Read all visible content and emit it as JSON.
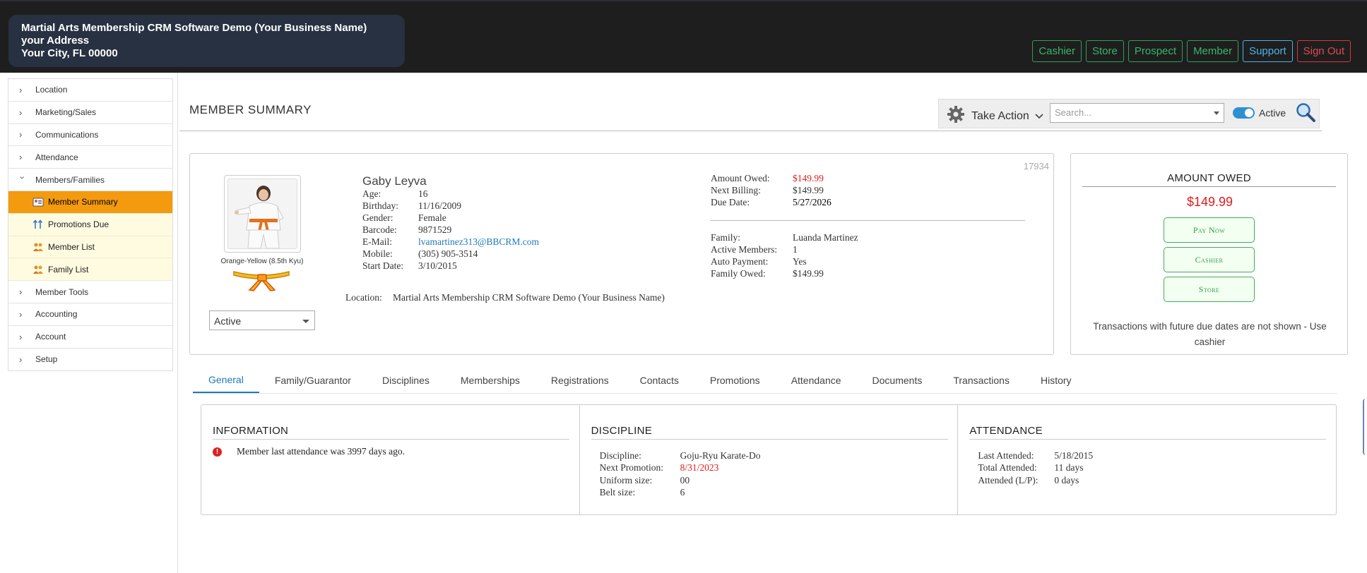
{
  "header": {
    "business_line1": "Martial Arts Membership CRM Software Demo (Your Business Name)",
    "business_line2": "your Address",
    "business_line3": "Your City, FL 00000",
    "nav": [
      "Cashier",
      "Store",
      "Prospect",
      "Member",
      "Support",
      "Sign Out"
    ]
  },
  "sidebar": {
    "items_top": [
      "Location",
      "Marketing/Sales",
      "Communications",
      "Attendance",
      "Members/Families"
    ],
    "sub_items": [
      "Member Summary",
      "Promotions Due",
      "Member List",
      "Family List"
    ],
    "items_bottom": [
      "Member Tools",
      "Accounting",
      "Account",
      "Setup"
    ]
  },
  "page": {
    "title": "MEMBER SUMMARY",
    "take_action": "Take Action",
    "search_placeholder": "Search...",
    "active_label": "Active"
  },
  "member": {
    "id": "17934",
    "name": "Gaby Leyva",
    "rank": "Orange-Yellow (8.5th Kyu)",
    "status": "Active",
    "details": [
      {
        "label": "Age:",
        "value": "16"
      },
      {
        "label": "Birthday:",
        "value": "11/16/2009"
      },
      {
        "label": "Gender:",
        "value": "Female"
      },
      {
        "label": "Barcode:",
        "value": "9871529"
      },
      {
        "label": "E-Mail:",
        "value": "lvamartinez313@BBCRM.com"
      },
      {
        "label": "Mobile:",
        "value": "(305) 905-3514"
      },
      {
        "label": "Start Date:",
        "value": "3/10/2015"
      }
    ],
    "location_label": "Location:",
    "location_value": "Martial Arts Membership CRM Software Demo (Your Business Name)",
    "billing": [
      {
        "label": "Amount Owed:",
        "value": "$149.99"
      },
      {
        "label": "Next Billing:",
        "value": "$149.99"
      },
      {
        "label": "Due Date:",
        "value": "5/27/2026"
      }
    ],
    "family": [
      {
        "label": "Family:",
        "value": "Luanda Martinez"
      },
      {
        "label": "Active Members:",
        "value": "1"
      },
      {
        "label": "Auto Payment:",
        "value": "Yes"
      },
      {
        "label": "Family Owed:",
        "value": "$149.99"
      }
    ]
  },
  "owed": {
    "title": "AMOUNT OWED",
    "amount": "$149.99",
    "buttons": [
      "Pay Now",
      "Cashier",
      "Store"
    ],
    "note": "Transactions with future due dates are not shown - Use cashier"
  },
  "tabs": [
    "General",
    "Family/Guarantor",
    "Disciplines",
    "Memberships",
    "Registrations",
    "Contacts",
    "Promotions",
    "Attendance",
    "Documents",
    "Transactions",
    "History"
  ],
  "panels": {
    "information": {
      "title": "INFORMATION",
      "message": "Member last attendance was 3997 days ago."
    },
    "discipline": {
      "title": "DISCIPLINE",
      "rows": [
        {
          "label": "Discipline:",
          "value": "Goju-Ryu Karate-Do"
        },
        {
          "label": "Next Promotion:",
          "value": "8/31/2023"
        },
        {
          "label": "Uniform size:",
          "value": "00"
        },
        {
          "label": "Belt size:",
          "value": "6"
        }
      ]
    },
    "attendance": {
      "title": "ATTENDANCE",
      "rows": [
        {
          "label": "Last Attended:",
          "value": "5/18/2015"
        },
        {
          "label": "Total Attended:",
          "value": "11 days"
        },
        {
          "label": "Attended (L/P):",
          "value": "0 days"
        }
      ]
    }
  },
  "colors": {
    "accent": "#1d7ab8",
    "active_nav": "#f39a0f",
    "owed_red": "#e01b1b",
    "green": "#38b66a"
  }
}
